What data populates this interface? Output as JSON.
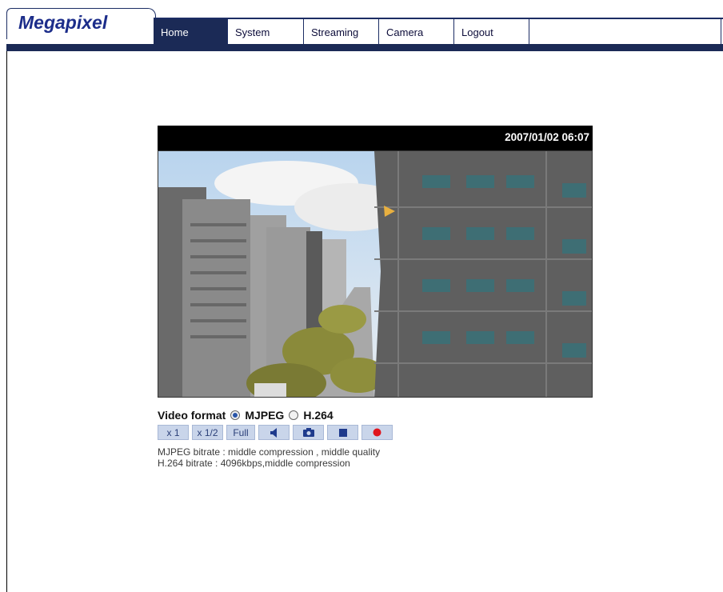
{
  "header": {
    "logo": "Megapixel",
    "nav": [
      {
        "label": "Home",
        "active": true
      },
      {
        "label": "System",
        "active": false
      },
      {
        "label": "Streaming",
        "active": false
      },
      {
        "label": "Camera",
        "active": false
      },
      {
        "label": "Logout",
        "active": false
      }
    ]
  },
  "viewer": {
    "timestamp": "2007/01/02 06:07"
  },
  "video_format": {
    "label": "Video format",
    "options": [
      {
        "label": "MJPEG",
        "selected": true
      },
      {
        "label": "H.264",
        "selected": false
      }
    ]
  },
  "controls": {
    "x1": "x 1",
    "x_half": "x 1/2",
    "full": "Full",
    "icons": [
      "speaker-icon",
      "camera-icon",
      "stop-icon",
      "record-icon"
    ]
  },
  "info": {
    "mjpeg": "MJPEG bitrate : middle compression , middle quality",
    "h264": "H.264 bitrate : 4096kbps,middle compression"
  },
  "colors": {
    "brand_navy": "#1b2a56",
    "logo_blue": "#1c2d8a",
    "button_bg": "#c9d5ea",
    "record_red": "#e0151d"
  }
}
